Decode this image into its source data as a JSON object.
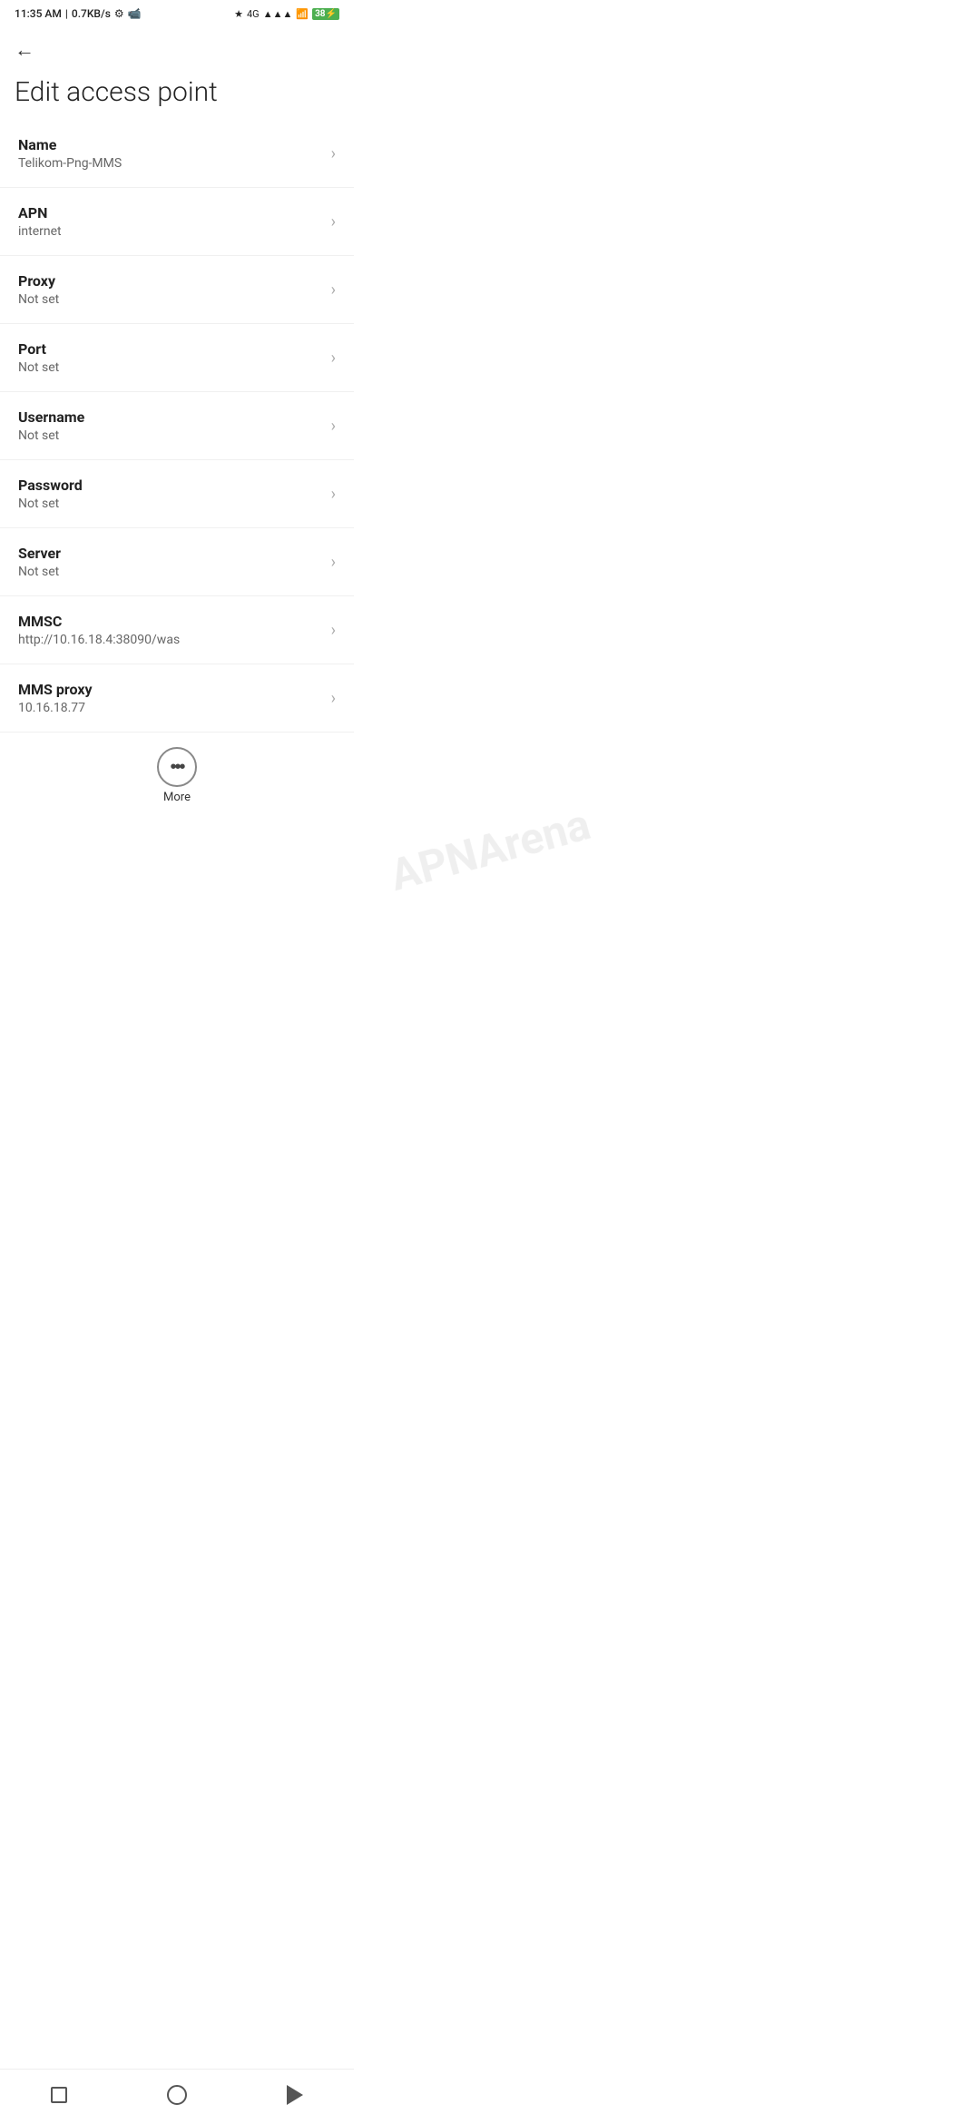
{
  "statusBar": {
    "time": "11:35 AM",
    "network_speed": "0.7KB/s",
    "bluetooth_icon": "bluetooth",
    "network_type": "4G",
    "signal_icon": "signal",
    "battery_level": "38",
    "battery_symbol": "⚡"
  },
  "header": {
    "back_icon": "←",
    "page_title": "Edit access point"
  },
  "settings": {
    "items": [
      {
        "label": "Name",
        "value": "Telikom-Png-MMS"
      },
      {
        "label": "APN",
        "value": "internet"
      },
      {
        "label": "Proxy",
        "value": "Not set"
      },
      {
        "label": "Port",
        "value": "Not set"
      },
      {
        "label": "Username",
        "value": "Not set"
      },
      {
        "label": "Password",
        "value": "Not set"
      },
      {
        "label": "Server",
        "value": "Not set"
      },
      {
        "label": "MMSC",
        "value": "http://10.16.18.4:38090/was"
      },
      {
        "label": "MMS proxy",
        "value": "10.16.18.77"
      }
    ]
  },
  "more": {
    "icon": "•••",
    "label": "More"
  },
  "watermark": {
    "line1": "APNArena"
  },
  "nav": {
    "square_label": "square",
    "circle_label": "home",
    "triangle_label": "back"
  }
}
